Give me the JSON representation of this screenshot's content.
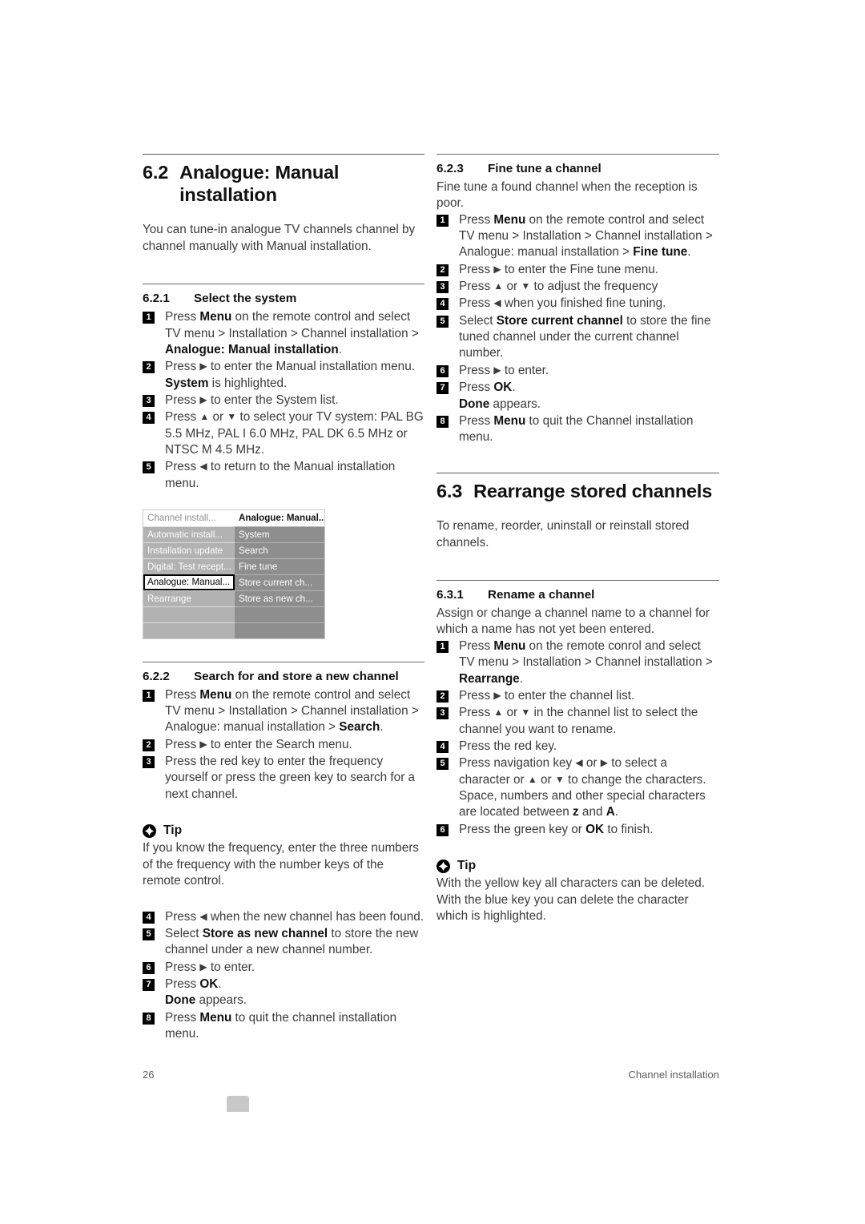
{
  "document": {
    "page_number": "26",
    "chapter_footer": "Channel installation"
  },
  "left_column": {
    "section": {
      "number": "6.2",
      "title": "Analogue: Manual installation",
      "intro": "You can tune-in analogue TV channels channel by channel manually with Manual installation."
    },
    "sub_6_2_1": {
      "number": "6.2.1",
      "title": "Select the system",
      "steps": [
        {
          "n": "1",
          "html": "Press <b>Menu</b> on the remote control and select TV menu &gt; Installation &gt; Channel installation &gt; <b>Analogue: Manual installation</b>."
        },
        {
          "n": "2",
          "html": "Press <span class=\"arrow\">&#9654;</span> to enter the Manual installation menu. <b>System</b> is highlighted."
        },
        {
          "n": "3",
          "html": "Press <span class=\"arrow\">&#9654;</span> to enter the System list."
        },
        {
          "n": "4",
          "html": "Press <span class=\"arrow\">&#9650;</span> or <span class=\"arrow\">&#9660;</span> to select your TV system: PAL BG 5.5 MHz, PAL I 6.0 MHz, PAL DK 6.5 MHz or NTSC M 4.5 MHz."
        },
        {
          "n": "5",
          "html": "Press <span class=\"arrow\">&#9664;</span> to return to the Manual installation menu."
        }
      ]
    },
    "menu_figure": {
      "header_left": "Channel install...",
      "header_right": "Analogue: Manual...",
      "rows": [
        {
          "left": "Automatic install...",
          "right": "System",
          "selected": false
        },
        {
          "left": "Installation update",
          "right": "Search",
          "selected": false
        },
        {
          "left": "Digital: Test recept...",
          "right": "Fine tune",
          "selected": false
        },
        {
          "left": "Analogue: Manual...",
          "right": "Store current ch...",
          "selected": true
        },
        {
          "left": "Rearrange",
          "right": "Store as new ch...",
          "selected": false
        },
        {
          "left": "",
          "right": "",
          "selected": false
        },
        {
          "left": "",
          "right": "",
          "selected": false
        }
      ]
    },
    "sub_6_2_2": {
      "number": "6.2.2",
      "title": "Search for and store a new channel",
      "steps_before_tip": [
        {
          "n": "1",
          "html": "Press <b>Menu</b> on the remote control and select TV menu &gt; Installation &gt; Channel installation &gt; Analogue: manual installation &gt; <b>Search</b>."
        },
        {
          "n": "2",
          "html": "Press <span class=\"arrow\">&#9654;</span> to enter the Search menu."
        },
        {
          "n": "3",
          "html": "Press the red key to enter the frequency yourself or press the green key to search for a next channel."
        }
      ],
      "tip": {
        "label": "Tip",
        "text": "If you know the frequency, enter the three numbers of the frequency with the number keys of the remote control."
      },
      "steps_after_tip": [
        {
          "n": "4",
          "html": "Press <span class=\"arrow\">&#9664;</span> when the new channel has been found."
        },
        {
          "n": "5",
          "html": "Select <b>Store as new channel</b> to store the new channel under a new channel number."
        },
        {
          "n": "6",
          "html": "Press <span class=\"arrow\">&#9654;</span> to enter."
        },
        {
          "n": "7",
          "html": "Press <b>OK</b>.<br><b>Done</b> appears."
        },
        {
          "n": "8",
          "html": "Press <b>Menu</b> to quit the channel installation menu."
        }
      ]
    }
  },
  "right_column": {
    "sub_6_2_3": {
      "number": "6.2.3",
      "title": "Fine tune a channel",
      "intro": "Fine tune a found channel when the reception is poor.",
      "steps": [
        {
          "n": "1",
          "html": "Press <b>Menu</b> on the remote control and select TV menu &gt; Installation &gt; Channel installation &gt; Analogue: manual installation &gt; <b>Fine tune</b>."
        },
        {
          "n": "2",
          "html": "Press <span class=\"arrow\">&#9654;</span> to enter the Fine tune menu."
        },
        {
          "n": "3",
          "html": "Press <span class=\"arrow\">&#9650;</span> or <span class=\"arrow\">&#9660;</span> to adjust the frequency"
        },
        {
          "n": "4",
          "html": "Press <span class=\"arrow\">&#9664;</span> when you finished fine tuning."
        },
        {
          "n": "5",
          "html": "Select <b>Store current channel</b> to store the fine tuned channel under the current channel number."
        },
        {
          "n": "6",
          "html": "Press <span class=\"arrow\">&#9654;</span> to enter."
        },
        {
          "n": "7",
          "html": "Press <b>OK</b>.<br><b>Done</b> appears."
        },
        {
          "n": "8",
          "html": "Press <b>Menu</b> to quit the Channel installation menu."
        }
      ]
    },
    "section": {
      "number": "6.3",
      "title": "Rearrange stored channels",
      "intro": "To rename, reorder, uninstall or reinstall stored channels."
    },
    "sub_6_3_1": {
      "number": "6.3.1",
      "title": "Rename a channel",
      "intro": "Assign or change a channel name to a channel for which a name has not yet been entered.",
      "steps": [
        {
          "n": "1",
          "html": "Press <b>Menu</b> on the remote conrol and select TV menu &gt; Installation &gt; Channel installation &gt; <b>Rearrange</b>."
        },
        {
          "n": "2",
          "html": "Press <span class=\"arrow\">&#9654;</span> to enter the channel list."
        },
        {
          "n": "3",
          "html": "Press <span class=\"arrow\">&#9650;</span> or <span class=\"arrow\">&#9660;</span> in the channel list to select the channel you want to rename."
        },
        {
          "n": "4",
          "html": "Press the red key."
        },
        {
          "n": "5",
          "html": "Press navigation key <span class=\"arrow\">&#9664;</span> or <span class=\"arrow\">&#9654;</span> to select a character or <span class=\"arrow\">&#9650;</span> or <span class=\"arrow\">&#9660;</span> to change the characters. Space, numbers and other special characters are located between <b>z</b> and <b>A</b>."
        },
        {
          "n": "6",
          "html": "Press the green key or <b>OK</b> to finish."
        }
      ],
      "tip": {
        "label": "Tip",
        "text": "With the yellow key all characters can be deleted. With the blue key you can delete the character which is highlighted."
      }
    }
  },
  "colors": {
    "body_text": "#3b3b3b",
    "heading_text": "#111111",
    "badge_bg": "#000000",
    "menu_left_cell": "#b2b2b2",
    "menu_right_cell": "#8e8e8e",
    "tab_marker": "#c8c8c8"
  }
}
